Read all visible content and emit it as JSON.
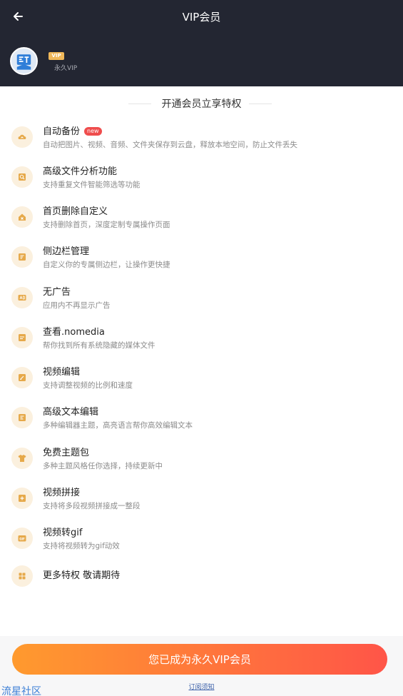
{
  "header": {
    "title": "VIP会员",
    "back_icon": "arrow-left-icon",
    "user": {
      "badge": "VIP",
      "level": "永久VIP",
      "avatar_icon": "app-logo-avatar"
    }
  },
  "section_title": "开通会员立享特权",
  "features": [
    {
      "title": "自动备份",
      "badge": "new",
      "desc": "自动把图片、视频、音频、文件夹保存到云盘，释放本地空间，防止文件丢失",
      "icon": "cloud-sync-icon"
    },
    {
      "title": "高级文件分析功能",
      "desc": "支持重复文件智能筛选等功能",
      "icon": "file-search-icon"
    },
    {
      "title": "首页删除自定义",
      "desc": "支持删除首页，深度定制专属操作页面",
      "icon": "home-delete-icon"
    },
    {
      "title": "侧边栏管理",
      "desc": "自定义你的专属侧边栏，让操作更快捷",
      "icon": "sidebar-edit-icon"
    },
    {
      "title": "无广告",
      "desc": "应用内不再显示广告",
      "icon": "no-ad-icon"
    },
    {
      "title": "查看.nomedia",
      "desc": "帮你找到所有系统隐藏的媒体文件",
      "icon": "hidden-media-icon"
    },
    {
      "title": "视频编辑",
      "desc": "支持调整视频的比例和速度",
      "icon": "video-edit-icon"
    },
    {
      "title": "高级文本编辑",
      "desc": "多种编辑器主题，高亮语言帮你高效编辑文本",
      "icon": "text-edit-icon"
    },
    {
      "title": "免费主题包",
      "desc": "多种主题风格任你选择，持续更新中",
      "icon": "tshirt-icon"
    },
    {
      "title": "视频拼接",
      "desc": "支持将多段视频拼接成一整段",
      "icon": "video-merge-icon"
    },
    {
      "title": "视频转gif",
      "desc": "支持将视频转为gif动效",
      "icon": "gif-icon"
    },
    {
      "title": "更多特权 敬请期待",
      "desc": "",
      "icon": "grid-icon"
    }
  ],
  "cta": {
    "label": "您已成为永久VIP会员"
  },
  "terms": {
    "label": "订阅须知"
  },
  "watermark": "流星社区",
  "colors": {
    "header_bg": "#232632",
    "accent_gold": "#f0b85a",
    "icon_circle": "#fbf0de",
    "cta_start": "#ff9a2e",
    "cta_end": "#ff5548",
    "new_badge": "#ef4d4d"
  }
}
